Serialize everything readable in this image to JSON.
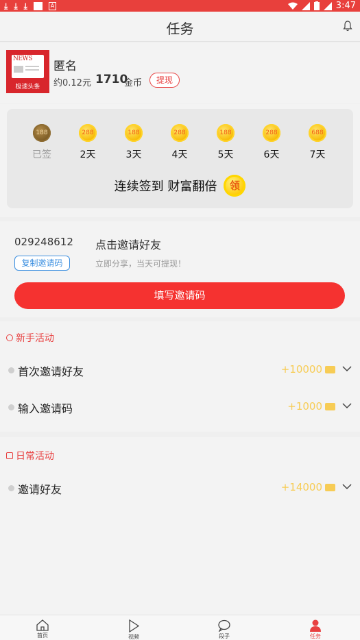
{
  "status_bar": {
    "time": "3:47"
  },
  "header": {
    "title": "任务"
  },
  "profile": {
    "avatar_title": "NEWS",
    "avatar_caption": "极速头条",
    "name": "匿名",
    "approx_money": "约0.12元",
    "coins": "1710",
    "coins_unit": "金币",
    "withdraw_label": "提现"
  },
  "signin": {
    "days": [
      {
        "coin": "188",
        "label": "已签",
        "signed": true
      },
      {
        "coin": "288",
        "label": "2天",
        "signed": false
      },
      {
        "coin": "188",
        "label": "3天",
        "signed": false
      },
      {
        "coin": "288",
        "label": "4天",
        "signed": false
      },
      {
        "coin": "188",
        "label": "5天",
        "signed": false
      },
      {
        "coin": "288",
        "label": "6天",
        "signed": false
      },
      {
        "coin": "688",
        "label": "7天",
        "signed": false
      }
    ],
    "slogan": "连续签到 财富翻倍",
    "claim_label": "领"
  },
  "invite": {
    "code": "029248612",
    "title": "点击邀请好友",
    "copy_label": "复制邀请码",
    "subtitle": "立即分享，当天可提现！",
    "fill_label": "填写邀请码"
  },
  "newbie": {
    "title": "新手活动",
    "items": [
      {
        "name": "首次邀请好友",
        "reward": "+10000"
      },
      {
        "name": "输入邀请码",
        "reward": "+1000"
      }
    ]
  },
  "daily": {
    "title": "日常活动",
    "items": [
      {
        "name": "邀请好友",
        "reward": "+14000"
      }
    ]
  },
  "tabs": [
    {
      "label": "首页",
      "icon": "home-icon",
      "active": false
    },
    {
      "label": "视频",
      "icon": "play-icon",
      "active": false
    },
    {
      "label": "段子",
      "icon": "chat-icon",
      "active": false
    },
    {
      "label": "任务",
      "icon": "user-icon",
      "active": true
    }
  ],
  "colors": {
    "accent": "#e84040",
    "button": "#f53230",
    "reward": "#f7cc55",
    "link": "#3b8fe0"
  }
}
